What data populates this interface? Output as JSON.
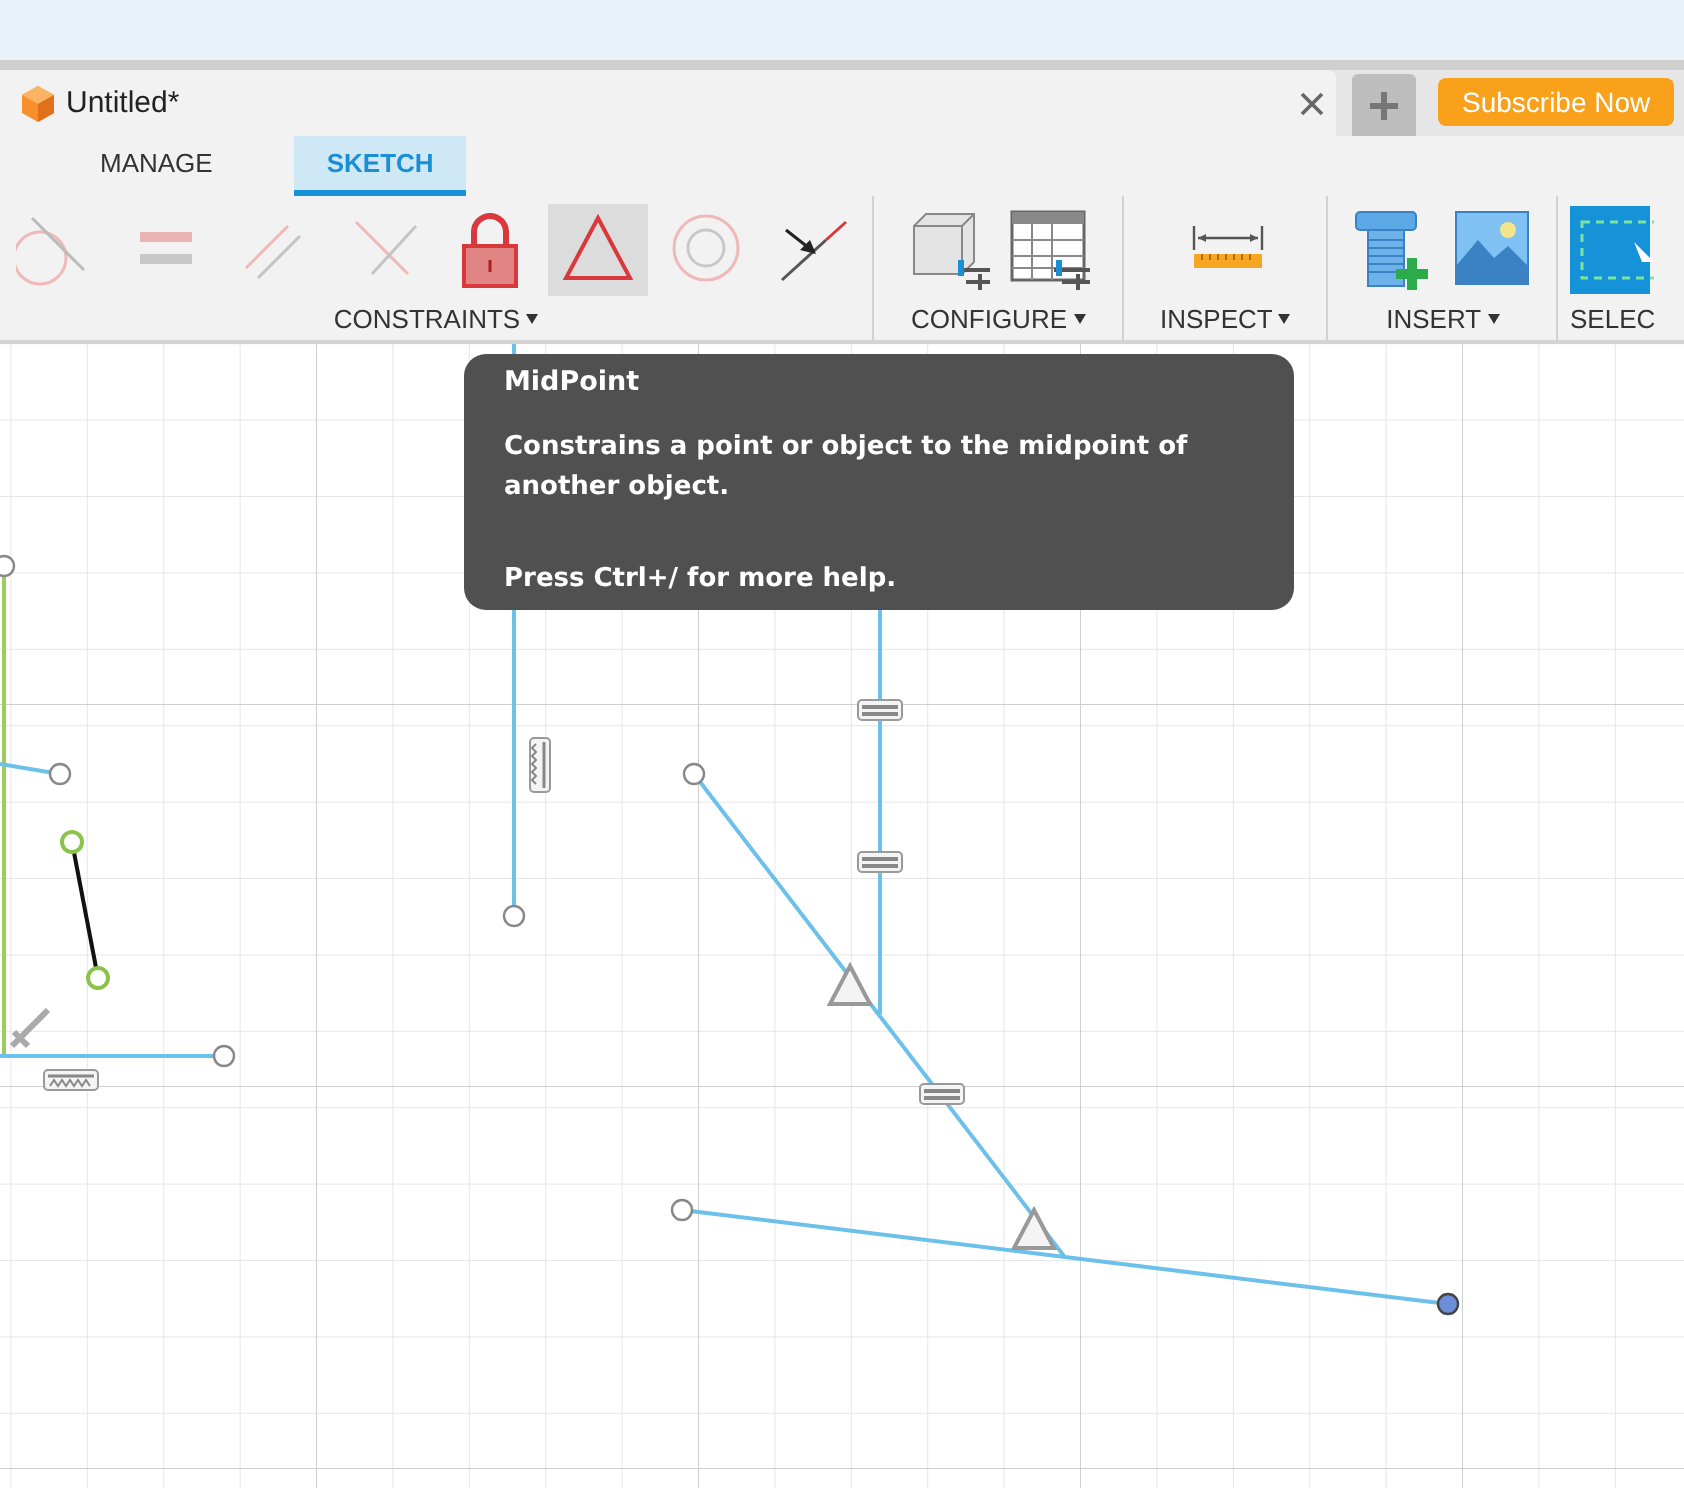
{
  "document_tab": {
    "title": "Untitled*"
  },
  "subscribe_button": "Subscribe Now",
  "ribbon_tabs": [
    {
      "label": "MANAGE",
      "selected": false
    },
    {
      "label": "SKETCH",
      "selected": true
    }
  ],
  "toolbar_groups": [
    {
      "label": "CONSTRAINTS",
      "dropdown": true,
      "tools": [
        {
          "kind": "tangent",
          "selected": false
        },
        {
          "kind": "equal",
          "selected": false
        },
        {
          "kind": "parallel",
          "selected": false
        },
        {
          "kind": "perpendicular",
          "selected": false
        },
        {
          "kind": "fix",
          "selected": false
        },
        {
          "kind": "midpoint",
          "selected": true
        },
        {
          "kind": "concentric",
          "selected": false
        },
        {
          "kind": "coincident",
          "selected": false
        }
      ]
    },
    {
      "label": "CONFIGURE",
      "dropdown": true,
      "tools": [
        {
          "kind": "configure-solid",
          "selected": false
        },
        {
          "kind": "configure-table",
          "selected": false
        }
      ]
    },
    {
      "label": "INSPECT",
      "dropdown": true,
      "tools": [
        {
          "kind": "measure",
          "selected": false
        }
      ]
    },
    {
      "label": "INSERT",
      "dropdown": true,
      "tools": [
        {
          "kind": "insert-bolt",
          "selected": false
        },
        {
          "kind": "insert-image",
          "selected": false
        }
      ]
    },
    {
      "label": "SELEC",
      "dropdown": false,
      "tools": [
        {
          "kind": "select",
          "selected": false
        }
      ]
    }
  ],
  "tooltip": {
    "title": "MidPoint",
    "description": "Constrains a point or object to the midpoint of another object.",
    "hint": "Press Ctrl+/ for more help."
  }
}
